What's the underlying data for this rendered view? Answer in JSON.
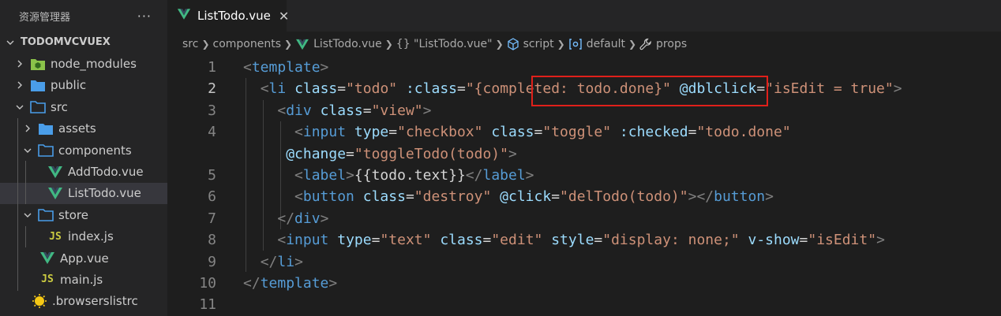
{
  "explorer": {
    "title": "资源管理器",
    "more": "···",
    "project": "TODOMVCVUEX",
    "items": [
      {
        "label": "node_modules",
        "icon": "node-modules-folder-icon"
      },
      {
        "label": "public",
        "icon": "folder-icon"
      },
      {
        "label": "src",
        "icon": "folder-open-icon"
      },
      {
        "label": "assets",
        "icon": "folder-icon"
      },
      {
        "label": "components",
        "icon": "folder-open-icon"
      },
      {
        "label": "AddTodo.vue",
        "icon": "vue-icon"
      },
      {
        "label": "ListTodo.vue",
        "icon": "vue-icon"
      },
      {
        "label": "store",
        "icon": "folder-open-icon"
      },
      {
        "label": "index.js",
        "icon": "js-icon",
        "glyph": "JS"
      },
      {
        "label": "App.vue",
        "icon": "vue-icon"
      },
      {
        "label": "main.js",
        "icon": "js-icon",
        "glyph": "JS"
      },
      {
        "label": ".browserslistrc",
        "icon": "browserslist-icon"
      }
    ]
  },
  "tab": {
    "title": "ListTodo.vue",
    "close": "✕"
  },
  "breadcrumb": {
    "items": [
      "src",
      "components",
      "ListTodo.vue",
      "{} \"ListTodo.vue\"",
      "script",
      "default",
      "props"
    ]
  },
  "code": {
    "line_numbers": [
      "1",
      "2",
      "3",
      "4",
      "",
      "5",
      "6",
      "7",
      "8",
      "9",
      "10",
      "11"
    ],
    "active_line": 2
  },
  "colors": {
    "highlight": "#e0201a",
    "vue": "#41b883",
    "folder": "#4a9de8"
  }
}
